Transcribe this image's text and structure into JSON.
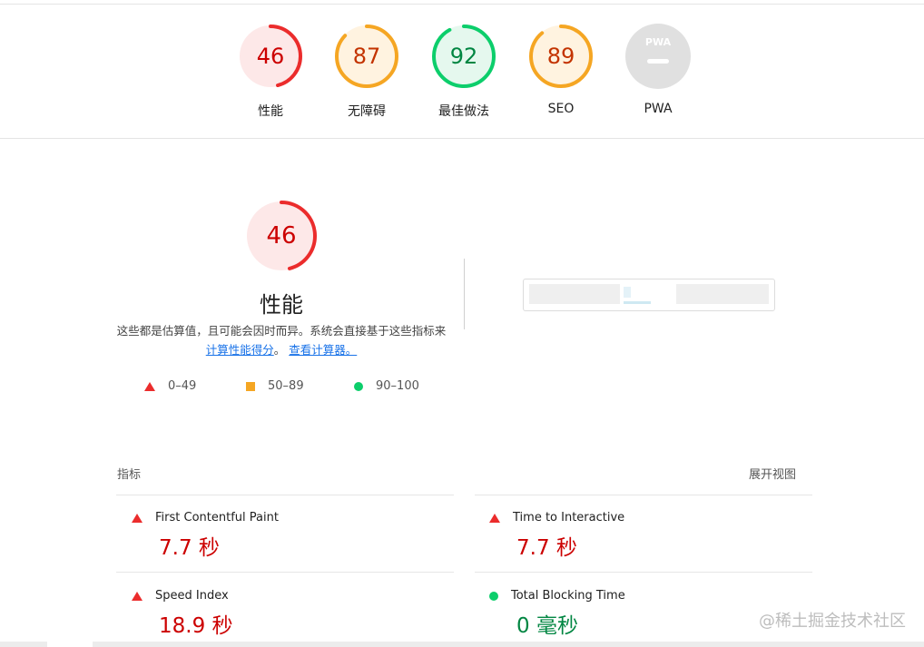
{
  "summary": {
    "gauges": [
      {
        "score": "46",
        "label": "性能",
        "color": "#eb2c2c",
        "fill": "#fde8e8",
        "text_color": "#c00",
        "fraction": 0.46
      },
      {
        "score": "87",
        "label": "无障碍",
        "color": "#f5a623",
        "fill": "#fff3e0",
        "text_color": "#c33300",
        "fraction": 0.87
      },
      {
        "score": "92",
        "label": "最佳做法",
        "color": "#0cce6b",
        "fill": "#e5f8ee",
        "text_color": "#018642",
        "fraction": 0.92
      },
      {
        "score": "89",
        "label": "SEO",
        "color": "#f5a623",
        "fill": "#fff3e0",
        "text_color": "#c33300",
        "fraction": 0.89
      }
    ],
    "pwa": {
      "label": "PWA",
      "badge_text": "PWA"
    }
  },
  "performance": {
    "score": "46",
    "fraction": 0.46,
    "title": "性能",
    "desc_prefix": "这些都是估算值，且可能会因时而异。系统会直接基于这些指标来",
    "link_calc": "计算性能得分",
    "desc_mid": "。",
    "link_view": "查看计算器。",
    "legend": [
      {
        "range": "0–49"
      },
      {
        "range": "50–89"
      },
      {
        "range": "90–100"
      }
    ]
  },
  "metrics": {
    "header": "指标",
    "expand_label": "展开视图",
    "items": [
      {
        "name": "First Contentful Paint",
        "value": "7.7 秒",
        "status": "fail"
      },
      {
        "name": "Time to Interactive",
        "value": "7.7 秒",
        "status": "fail"
      },
      {
        "name": "Speed Index",
        "value": "18.9 秒",
        "status": "fail"
      },
      {
        "name": "Total Blocking Time",
        "value": "0 毫秒",
        "status": "pass"
      }
    ]
  },
  "watermark": "@稀土掘金技术社区",
  "colors": {
    "fail": "#eb2c2c",
    "average": "#f5a623",
    "pass": "#0cce6b"
  }
}
